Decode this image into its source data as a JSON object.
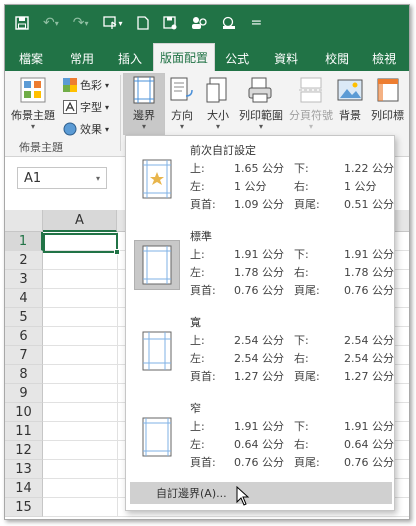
{
  "quick_access": {
    "icons": [
      "save-icon",
      "undo-icon",
      "redo-icon",
      "touch-mode-icon",
      "new-file-icon",
      "save-as-icon",
      "share-icon",
      "print-preview-icon",
      "customize-icon"
    ],
    "customize_glyph": "="
  },
  "ribbon_tabs": [
    "檔案",
    "常用",
    "插入",
    "版面配置",
    "公式",
    "資料",
    "校閱",
    "檢視"
  ],
  "active_tab": "版面配置",
  "ribbon": {
    "themes_label": "佈景主題",
    "colors_label": "色彩",
    "fonts_label": "字型",
    "effects_label": "效果",
    "margins_label": "邊界",
    "orientation_label": "方向",
    "size_label": "大小",
    "print_area_label": "列印範圍",
    "breaks_label": "分頁符號",
    "background_label": "背景",
    "print_titles_label": "列印標",
    "group_label": "佈景主題"
  },
  "name_box": {
    "value": "A1"
  },
  "grid": {
    "column": "A",
    "rows": [
      "1",
      "2",
      "3",
      "4",
      "5",
      "6",
      "7",
      "8",
      "9",
      "10",
      "11",
      "12",
      "13",
      "14",
      "15"
    ]
  },
  "margins_menu": {
    "options": [
      {
        "title": "前次自訂設定",
        "top_label": "上:",
        "top": "1.65 公分",
        "bottom_label": "下:",
        "bottom": "1.22 公分",
        "left_label": "左:",
        "left": "1 公分",
        "right_label": "右:",
        "right": "1 公分",
        "header_label": "頁首:",
        "header": "1.09 公分",
        "footer_label": "頁尾:",
        "footer": "0.51 公分"
      },
      {
        "title": "標準",
        "top_label": "上:",
        "top": "1.91 公分",
        "bottom_label": "下:",
        "bottom": "1.91 公分",
        "left_label": "左:",
        "left": "1.78 公分",
        "right_label": "右:",
        "right": "1.78 公分",
        "header_label": "頁首:",
        "header": "0.76 公分",
        "footer_label": "頁尾:",
        "footer": "0.76 公分"
      },
      {
        "title": "寬",
        "top_label": "上:",
        "top": "2.54 公分",
        "bottom_label": "下:",
        "bottom": "2.54 公分",
        "left_label": "左:",
        "left": "2.54 公分",
        "right_label": "右:",
        "right": "2.54 公分",
        "header_label": "頁首:",
        "header": "1.27 公分",
        "footer_label": "頁尾:",
        "footer": "1.27 公分"
      },
      {
        "title": "窄",
        "top_label": "上:",
        "top": "1.91 公分",
        "bottom_label": "下:",
        "bottom": "1.91 公分",
        "left_label": "左:",
        "left": "0.64 公分",
        "right_label": "右:",
        "right": "0.64 公分",
        "header_label": "頁首:",
        "header": "0.76 公分",
        "footer_label": "頁尾:",
        "footer": "0.76 公分"
      }
    ],
    "custom_label": "自訂邊界(A)..."
  },
  "colors": {
    "brand": "#217346",
    "ribbon_bg": "#f3f3f3",
    "selected": "#c8c8c8"
  }
}
